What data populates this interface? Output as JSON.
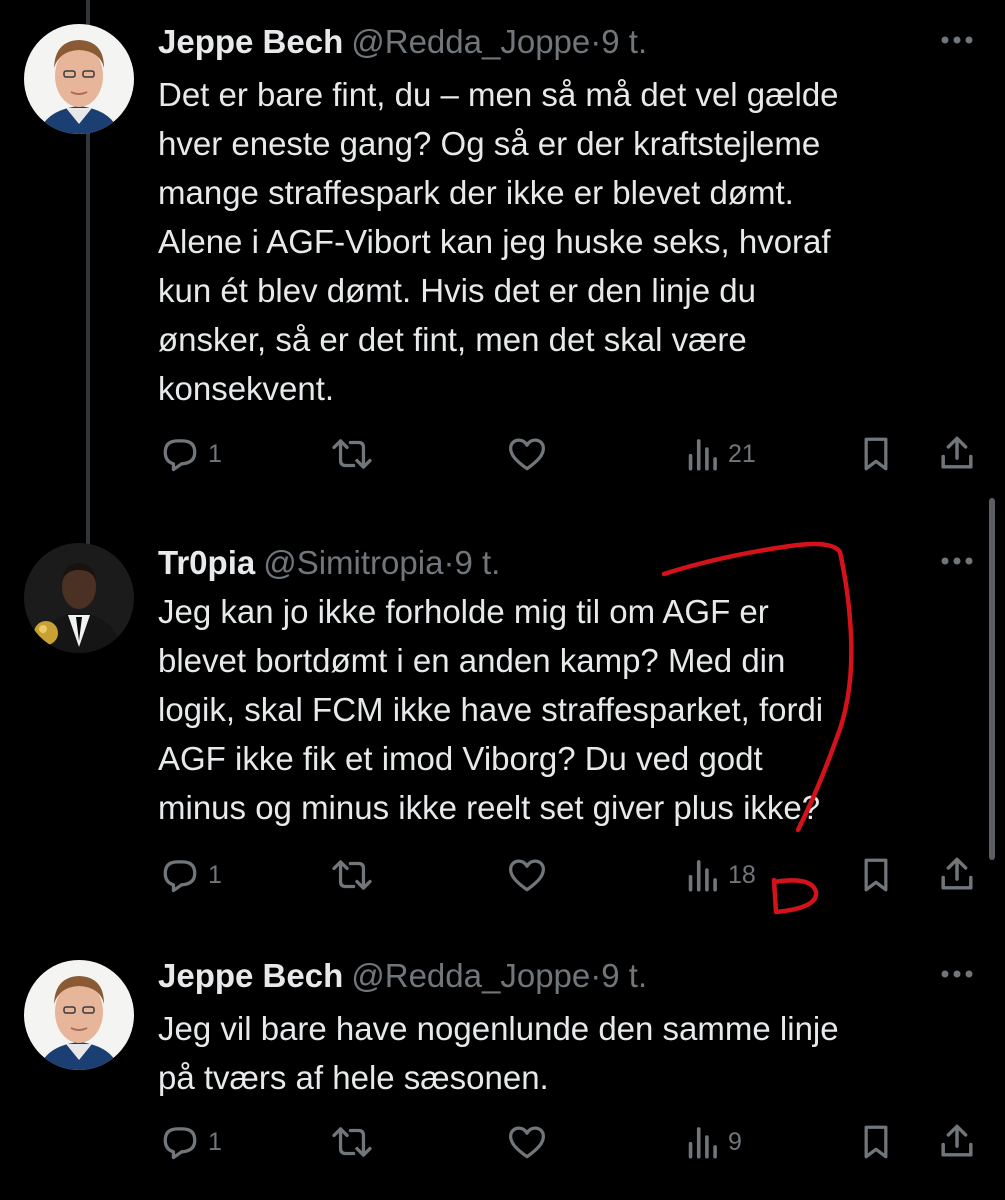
{
  "tweets": [
    {
      "name": "Jeppe Bech",
      "handle": "@Redda_Joppe",
      "separator": "·",
      "time": "9 t.",
      "text": "Det er bare fint, du – men så må det vel gælde\nhver eneste gang? Og så er der kraftstejleme\nmange straffespark der ikke er blevet dømt.\nAlene i AGF-Vibort kan jeg huske seks, hvoraf\nkun ét blev dømt. Hvis det er den linje du\nønsker, så er det fint, men det skal være\nkonsekvent.",
      "replies": "1",
      "views": "21"
    },
    {
      "name": "Tr0pia",
      "handle": "@Simitropia",
      "separator": "·",
      "time": "9 t.",
      "text": "Jeg kan jo ikke forholde mig til om AGF er\nblevet bortdømt i en anden kamp? Med din\nlogik, skal FCM ikke have straffesparket, fordi\nAGF ikke fik et imod Viborg? Du ved godt\nminus og minus ikke reelt set giver plus ikke?",
      "replies": "1",
      "views": "18"
    },
    {
      "name": "Jeppe Bech",
      "handle": "@Redda_Joppe",
      "separator": "·",
      "time": "9 t.",
      "text": "Jeg vil bare have nogenlunde den samme linje\npå tværs af hele sæsonen.",
      "replies": "1",
      "views": "9"
    }
  ],
  "colors": {
    "background": "#000000",
    "text": "#e7e9ea",
    "secondary": "#71767b",
    "annotation": "#d4121a"
  },
  "icons": [
    "reply-icon",
    "retweet-icon",
    "like-icon",
    "views-icon",
    "bookmark-icon",
    "share-icon",
    "more-icon"
  ]
}
